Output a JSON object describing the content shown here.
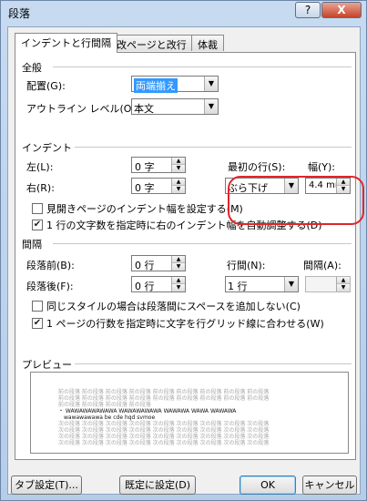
{
  "window": {
    "title": "段落",
    "help_glyph": "?",
    "close_glyph": "X"
  },
  "tabs": [
    {
      "label": "インデントと行間隔",
      "active": true
    },
    {
      "label": "改ページと改行",
      "active": false
    },
    {
      "label": "体裁",
      "active": false
    }
  ],
  "general": {
    "header": "全般",
    "alignment_label": "配置(G):",
    "alignment_value": "両端揃え",
    "outline_label": "アウトライン レベル(O):",
    "outline_value": "本文"
  },
  "indent": {
    "header": "インデント",
    "left_label": "左(L):",
    "left_value": "0 字",
    "right_label": "右(R):",
    "right_value": "0 字",
    "first_line_label": "最初の行(S):",
    "first_line_value": "ぶら下げ",
    "by_label": "幅(Y):",
    "by_value": "4.4 mm",
    "mirror_checkbox": "見開きページのインデント幅を設定する(M)",
    "mirror_checked": false,
    "auto_adjust_checkbox": "1 行の文字数を指定時に右のインデント幅を自動調整する(D)",
    "auto_adjust_checked": true
  },
  "spacing": {
    "header": "間隔",
    "before_label": "段落前(B):",
    "before_value": "0 行",
    "after_label": "段落後(F):",
    "after_value": "0 行",
    "line_spacing_label": "行間(N):",
    "line_spacing_value": "1 行",
    "at_label": "間隔(A):",
    "at_value": "",
    "no_space_checkbox": "同じスタイルの場合は段落間にスペースを追加しない(C)",
    "no_space_checked": false,
    "snap_grid_checkbox": "1 ページの行数を指定時に文字を行グリッド線に合わせる(W)",
    "snap_grid_checked": true
  },
  "preview": {
    "header": "プレビュー",
    "prev_lines": [
      "前の段落 前の段落 前の段落 前の段落 前の段落 前の段落 前の段落 前の段落 前の段落",
      "前の段落 前の段落 前の段落 前の段落 前の段落 前の段落 前の段落 前の段落 前の段落",
      "前の段落 前の段落 前の段落 前の段落"
    ],
    "sample_lines": [
      "・ WAWAWAWAWAWA WAWAWAWAWA WAWAWA WAWA WAWAWA",
      "wawawawawa be cde hqd svmoe"
    ],
    "next_lines": [
      "次の段落 次の段落 次の段落 次の段落 次の段落 次の段落 次の段落 次の段落 次の段落",
      "次の段落 次の段落 次の段落 次の段落 次の段落 次の段落 次の段落 次の段落 次の段落",
      "次の段落 次の段落 次の段落 次の段落 次の段落 次の段落 次の段落 次の段落 次の段落",
      "次の段落 次の段落 次の段落 次の段落 次の段落 次の段落 次の段落 次の段落 次の段落"
    ]
  },
  "buttons": {
    "tabs": "タブ設定(T)...",
    "default": "既定に設定(D)",
    "ok": "OK",
    "cancel": "キャンセル"
  },
  "colors": {
    "highlight_ring": "#e0262b",
    "selection": "#3399ff"
  }
}
